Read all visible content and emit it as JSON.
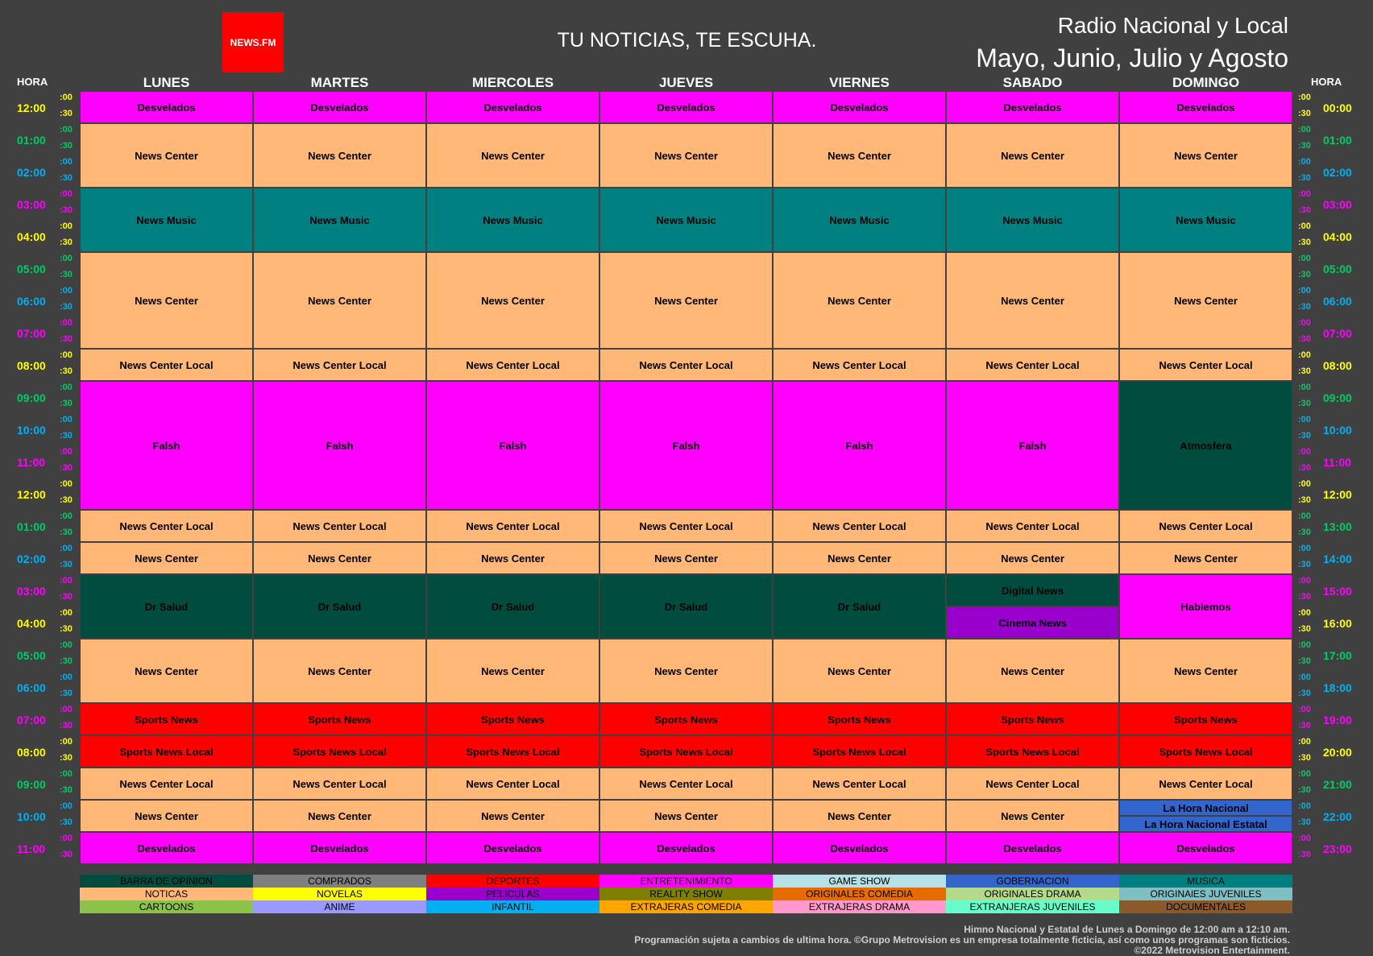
{
  "header": {
    "logo": "NEWS.FM",
    "slogan": "TU NOTICIAS, TE ESCUHA.",
    "title_line1": "Radio Nacional y Local",
    "title_line2": "Mayo, Junio, Julio y Agosto",
    "hora_left": "HORA",
    "hora_right": "HORA"
  },
  "days": [
    "LUNES",
    "MARTES",
    "MIERCOLES",
    "JUEVES",
    "VIERNES",
    "SABADO",
    "DOMINGO"
  ],
  "hours_left": [
    "12:00",
    "01:00",
    "02:00",
    "03:00",
    "04:00",
    "05:00",
    "06:00",
    "07:00",
    "08:00",
    "09:00",
    "10:00",
    "11:00",
    "12:00",
    "01:00",
    "02:00",
    "03:00",
    "04:00",
    "05:00",
    "06:00",
    "07:00",
    "08:00",
    "09:00",
    "10:00",
    "11:00"
  ],
  "hours_right": [
    "00:00",
    "01:00",
    "02:00",
    "03:00",
    "04:00",
    "05:00",
    "06:00",
    "07:00",
    "08:00",
    "09:00",
    "10:00",
    "11:00",
    "12:00",
    "13:00",
    "14:00",
    "15:00",
    "16:00",
    "17:00",
    "18:00",
    "19:00",
    "20:00",
    "21:00",
    "22:00",
    "23:00"
  ],
  "half_marks": [
    ":00",
    ":30"
  ],
  "hour_colors": [
    "#ffff00",
    "#00cc66",
    "#00b0f0",
    "#ff00ff"
  ],
  "colors": {
    "barra_de_opinion": "#004d40",
    "comprados": "#7f7f7f",
    "deportes": "#ff0000",
    "entretenimiento": "#ff00ff",
    "game_show": "#b7e1e8",
    "gobernacion": "#3366cc",
    "musica": "#008080",
    "noticias": "#ffb878",
    "novelas": "#ffff00",
    "peliculas": "#9900cc",
    "reality_show": "#808000",
    "originales_comedia": "#e66c00",
    "originales_drama": "#b3d98b",
    "originales_juveniles": "#7fbfc4",
    "cartoons": "#8bc34a",
    "anime": "#9999ff",
    "infantil": "#00b0f0",
    "extranjeras_comedia": "#ffa500",
    "extranjeras_drama": "#ff99cc",
    "extranjeras_juveniles": "#66ffcc",
    "documentales": "#8b5a2b"
  },
  "schedule": [
    [
      {
        "name": "Desvelados",
        "start": 0,
        "slots": 2,
        "cat": "entretenimiento"
      },
      {
        "name": "News Center",
        "start": 2,
        "slots": 4,
        "cat": "noticias"
      },
      {
        "name": "News Music",
        "start": 6,
        "slots": 4,
        "cat": "musica"
      },
      {
        "name": "News Center",
        "start": 10,
        "slots": 6,
        "cat": "noticias"
      },
      {
        "name": "News Center Local",
        "start": 16,
        "slots": 2,
        "cat": "noticias"
      },
      {
        "name": "Falsh",
        "start": 18,
        "slots": 8,
        "cat": "entretenimiento"
      },
      {
        "name": "News Center Local",
        "start": 26,
        "slots": 2,
        "cat": "noticias"
      },
      {
        "name": "News Center",
        "start": 28,
        "slots": 2,
        "cat": "noticias"
      },
      {
        "name": "Dr Salud",
        "start": 30,
        "slots": 4,
        "cat": "barra_de_opinion"
      },
      {
        "name": "News Center",
        "start": 34,
        "slots": 4,
        "cat": "noticias"
      },
      {
        "name": "Sports News",
        "start": 38,
        "slots": 2,
        "cat": "deportes"
      },
      {
        "name": "Sports News Local",
        "start": 40,
        "slots": 2,
        "cat": "deportes"
      },
      {
        "name": "News Center Local",
        "start": 42,
        "slots": 2,
        "cat": "noticias"
      },
      {
        "name": "News Center",
        "start": 44,
        "slots": 2,
        "cat": "noticias"
      },
      {
        "name": "Desvelados",
        "start": 46,
        "slots": 2,
        "cat": "entretenimiento"
      }
    ],
    [
      {
        "name": "Desvelados",
        "start": 0,
        "slots": 2,
        "cat": "entretenimiento"
      },
      {
        "name": "News Center",
        "start": 2,
        "slots": 4,
        "cat": "noticias"
      },
      {
        "name": "News Music",
        "start": 6,
        "slots": 4,
        "cat": "musica"
      },
      {
        "name": "News Center",
        "start": 10,
        "slots": 6,
        "cat": "noticias"
      },
      {
        "name": "News Center Local",
        "start": 16,
        "slots": 2,
        "cat": "noticias"
      },
      {
        "name": "Falsh",
        "start": 18,
        "slots": 8,
        "cat": "entretenimiento"
      },
      {
        "name": "News Center Local",
        "start": 26,
        "slots": 2,
        "cat": "noticias"
      },
      {
        "name": "News Center",
        "start": 28,
        "slots": 2,
        "cat": "noticias"
      },
      {
        "name": "Dr Salud",
        "start": 30,
        "slots": 4,
        "cat": "barra_de_opinion"
      },
      {
        "name": "News Center",
        "start": 34,
        "slots": 4,
        "cat": "noticias"
      },
      {
        "name": "Sports News",
        "start": 38,
        "slots": 2,
        "cat": "deportes"
      },
      {
        "name": "Sports News Local",
        "start": 40,
        "slots": 2,
        "cat": "deportes"
      },
      {
        "name": "News Center Local",
        "start": 42,
        "slots": 2,
        "cat": "noticias"
      },
      {
        "name": "News Center",
        "start": 44,
        "slots": 2,
        "cat": "noticias"
      },
      {
        "name": "Desvelados",
        "start": 46,
        "slots": 2,
        "cat": "entretenimiento"
      }
    ],
    [
      {
        "name": "Desvelados",
        "start": 0,
        "slots": 2,
        "cat": "entretenimiento"
      },
      {
        "name": "News Center",
        "start": 2,
        "slots": 4,
        "cat": "noticias"
      },
      {
        "name": "News Music",
        "start": 6,
        "slots": 4,
        "cat": "musica"
      },
      {
        "name": "News Center",
        "start": 10,
        "slots": 6,
        "cat": "noticias"
      },
      {
        "name": "News Center Local",
        "start": 16,
        "slots": 2,
        "cat": "noticias"
      },
      {
        "name": "Falsh",
        "start": 18,
        "slots": 8,
        "cat": "entretenimiento"
      },
      {
        "name": "News Center Local",
        "start": 26,
        "slots": 2,
        "cat": "noticias"
      },
      {
        "name": "News Center",
        "start": 28,
        "slots": 2,
        "cat": "noticias"
      },
      {
        "name": "Dr Salud",
        "start": 30,
        "slots": 4,
        "cat": "barra_de_opinion"
      },
      {
        "name": "News Center",
        "start": 34,
        "slots": 4,
        "cat": "noticias"
      },
      {
        "name": "Sports News",
        "start": 38,
        "slots": 2,
        "cat": "deportes"
      },
      {
        "name": "Sports News Local",
        "start": 40,
        "slots": 2,
        "cat": "deportes"
      },
      {
        "name": "News Center Local",
        "start": 42,
        "slots": 2,
        "cat": "noticias"
      },
      {
        "name": "News Center",
        "start": 44,
        "slots": 2,
        "cat": "noticias"
      },
      {
        "name": "Desvelados",
        "start": 46,
        "slots": 2,
        "cat": "entretenimiento"
      }
    ],
    [
      {
        "name": "Desvelados",
        "start": 0,
        "slots": 2,
        "cat": "entretenimiento"
      },
      {
        "name": "News Center",
        "start": 2,
        "slots": 4,
        "cat": "noticias"
      },
      {
        "name": "News Music",
        "start": 6,
        "slots": 4,
        "cat": "musica"
      },
      {
        "name": "News Center",
        "start": 10,
        "slots": 6,
        "cat": "noticias"
      },
      {
        "name": "News Center Local",
        "start": 16,
        "slots": 2,
        "cat": "noticias"
      },
      {
        "name": "Falsh",
        "start": 18,
        "slots": 8,
        "cat": "entretenimiento"
      },
      {
        "name": "News Center Local",
        "start": 26,
        "slots": 2,
        "cat": "noticias"
      },
      {
        "name": "News Center",
        "start": 28,
        "slots": 2,
        "cat": "noticias"
      },
      {
        "name": "Dr Salud",
        "start": 30,
        "slots": 4,
        "cat": "barra_de_opinion"
      },
      {
        "name": "News Center",
        "start": 34,
        "slots": 4,
        "cat": "noticias"
      },
      {
        "name": "Sports News",
        "start": 38,
        "slots": 2,
        "cat": "deportes"
      },
      {
        "name": "Sports News Local",
        "start": 40,
        "slots": 2,
        "cat": "deportes"
      },
      {
        "name": "News Center Local",
        "start": 42,
        "slots": 2,
        "cat": "noticias"
      },
      {
        "name": "News Center",
        "start": 44,
        "slots": 2,
        "cat": "noticias"
      },
      {
        "name": "Desvelados",
        "start": 46,
        "slots": 2,
        "cat": "entretenimiento"
      }
    ],
    [
      {
        "name": "Desvelados",
        "start": 0,
        "slots": 2,
        "cat": "entretenimiento"
      },
      {
        "name": "News Center",
        "start": 2,
        "slots": 4,
        "cat": "noticias"
      },
      {
        "name": "News Music",
        "start": 6,
        "slots": 4,
        "cat": "musica"
      },
      {
        "name": "News Center",
        "start": 10,
        "slots": 6,
        "cat": "noticias"
      },
      {
        "name": "News Center Local",
        "start": 16,
        "slots": 2,
        "cat": "noticias"
      },
      {
        "name": "Falsh",
        "start": 18,
        "slots": 8,
        "cat": "entretenimiento"
      },
      {
        "name": "News Center Local",
        "start": 26,
        "slots": 2,
        "cat": "noticias"
      },
      {
        "name": "News Center",
        "start": 28,
        "slots": 2,
        "cat": "noticias"
      },
      {
        "name": "Dr Salud",
        "start": 30,
        "slots": 4,
        "cat": "barra_de_opinion"
      },
      {
        "name": "News Center",
        "start": 34,
        "slots": 4,
        "cat": "noticias"
      },
      {
        "name": "Sports News",
        "start": 38,
        "slots": 2,
        "cat": "deportes"
      },
      {
        "name": "Sports News Local",
        "start": 40,
        "slots": 2,
        "cat": "deportes"
      },
      {
        "name": "News Center Local",
        "start": 42,
        "slots": 2,
        "cat": "noticias"
      },
      {
        "name": "News Center",
        "start": 44,
        "slots": 2,
        "cat": "noticias"
      },
      {
        "name": "Desvelados",
        "start": 46,
        "slots": 2,
        "cat": "entretenimiento"
      }
    ],
    [
      {
        "name": "Desvelados",
        "start": 0,
        "slots": 2,
        "cat": "entretenimiento"
      },
      {
        "name": "News Center",
        "start": 2,
        "slots": 4,
        "cat": "noticias"
      },
      {
        "name": "News Music",
        "start": 6,
        "slots": 4,
        "cat": "musica"
      },
      {
        "name": "News Center",
        "start": 10,
        "slots": 6,
        "cat": "noticias"
      },
      {
        "name": "News Center Local",
        "start": 16,
        "slots": 2,
        "cat": "noticias"
      },
      {
        "name": "Falsh",
        "start": 18,
        "slots": 8,
        "cat": "entretenimiento"
      },
      {
        "name": "News Center Local",
        "start": 26,
        "slots": 2,
        "cat": "noticias"
      },
      {
        "name": "News Center",
        "start": 28,
        "slots": 2,
        "cat": "noticias"
      },
      {
        "name": "Digital News",
        "start": 30,
        "slots": 2,
        "cat": "barra_de_opinion"
      },
      {
        "name": "Cinema News",
        "start": 32,
        "slots": 2,
        "cat": "peliculas"
      },
      {
        "name": "News Center",
        "start": 34,
        "slots": 4,
        "cat": "noticias"
      },
      {
        "name": "Sports News",
        "start": 38,
        "slots": 2,
        "cat": "deportes"
      },
      {
        "name": "Sports News Local",
        "start": 40,
        "slots": 2,
        "cat": "deportes"
      },
      {
        "name": "News Center Local",
        "start": 42,
        "slots": 2,
        "cat": "noticias"
      },
      {
        "name": "News Center",
        "start": 44,
        "slots": 2,
        "cat": "noticias"
      },
      {
        "name": "Desvelados",
        "start": 46,
        "slots": 2,
        "cat": "entretenimiento"
      }
    ],
    [
      {
        "name": "Desvelados",
        "start": 0,
        "slots": 2,
        "cat": "entretenimiento"
      },
      {
        "name": "News Center",
        "start": 2,
        "slots": 4,
        "cat": "noticias"
      },
      {
        "name": "News Music",
        "start": 6,
        "slots": 4,
        "cat": "musica"
      },
      {
        "name": "News Center",
        "start": 10,
        "slots": 6,
        "cat": "noticias"
      },
      {
        "name": "News Center Local",
        "start": 16,
        "slots": 2,
        "cat": "noticias"
      },
      {
        "name": "Atmosfera",
        "start": 18,
        "slots": 8,
        "cat": "barra_de_opinion"
      },
      {
        "name": "News Center Local",
        "start": 26,
        "slots": 2,
        "cat": "noticias"
      },
      {
        "name": "News Center",
        "start": 28,
        "slots": 2,
        "cat": "noticias"
      },
      {
        "name": "Hablemos",
        "start": 30,
        "slots": 4,
        "cat": "entretenimiento"
      },
      {
        "name": "News Center",
        "start": 34,
        "slots": 4,
        "cat": "noticias"
      },
      {
        "name": "Sports News",
        "start": 38,
        "slots": 2,
        "cat": "deportes"
      },
      {
        "name": "Sports News Local",
        "start": 40,
        "slots": 2,
        "cat": "deportes"
      },
      {
        "name": "News Center Local",
        "start": 42,
        "slots": 2,
        "cat": "noticias"
      },
      {
        "name": "La Hora Nacional",
        "start": 44,
        "slots": 1,
        "cat": "gobernacion"
      },
      {
        "name": "La Hora Nacional Estatal",
        "start": 45,
        "slots": 1,
        "cat": "gobernacion"
      },
      {
        "name": "Desvelados",
        "start": 46,
        "slots": 2,
        "cat": "entretenimiento"
      }
    ]
  ],
  "legend": [
    {
      "label": "BARRA DE OPINION",
      "cat": "barra_de_opinion"
    },
    {
      "label": "COMPRADOS",
      "cat": "comprados"
    },
    {
      "label": "DEPORTES",
      "cat": "deportes"
    },
    {
      "label": "ENTRETENIMIENTO",
      "cat": "entretenimiento"
    },
    {
      "label": "GAME SHOW",
      "cat": "game_show"
    },
    {
      "label": "GOBERNACION",
      "cat": "gobernacion"
    },
    {
      "label": "MUSICA",
      "cat": "musica"
    },
    {
      "label": "NOTICAS",
      "cat": "noticias"
    },
    {
      "label": "NOVELAS",
      "cat": "novelas"
    },
    {
      "label": "PELICULAS",
      "cat": "peliculas"
    },
    {
      "label": "REALITY SHOW",
      "cat": "reality_show"
    },
    {
      "label": "ORIGINALES COMEDIA",
      "cat": "originales_comedia"
    },
    {
      "label": "ORIGINALES DRAMA",
      "cat": "originales_drama"
    },
    {
      "label": "ORIGINAlES JUVENILES",
      "cat": "originales_juveniles"
    },
    {
      "label": "CARTOONS",
      "cat": "cartoons"
    },
    {
      "label": "ANIME",
      "cat": "anime"
    },
    {
      "label": "INFANTIL",
      "cat": "infantil"
    },
    {
      "label": "EXTRAJERAS COMEDIA",
      "cat": "extranjeras_comedia"
    },
    {
      "label": "EXTRAJERAS DRAMA",
      "cat": "extranjeras_drama"
    },
    {
      "label": "EXTRANJERAS JUVENILES",
      "cat": "extranjeras_juveniles"
    },
    {
      "label": "DOCUMENTALES",
      "cat": "documentales"
    }
  ],
  "footer": {
    "line1": "Himno Nacional y Estatal de Lunes a Domingo de 12:00 am a 12:10 am.",
    "line2": "Programación sujeta a cambios de ultima hora. ©Grupo Metrovision es un empresa totalmente ficticia, así como unos programas son ficticios.",
    "line3": "©2022 Metrovision Entertainment."
  }
}
